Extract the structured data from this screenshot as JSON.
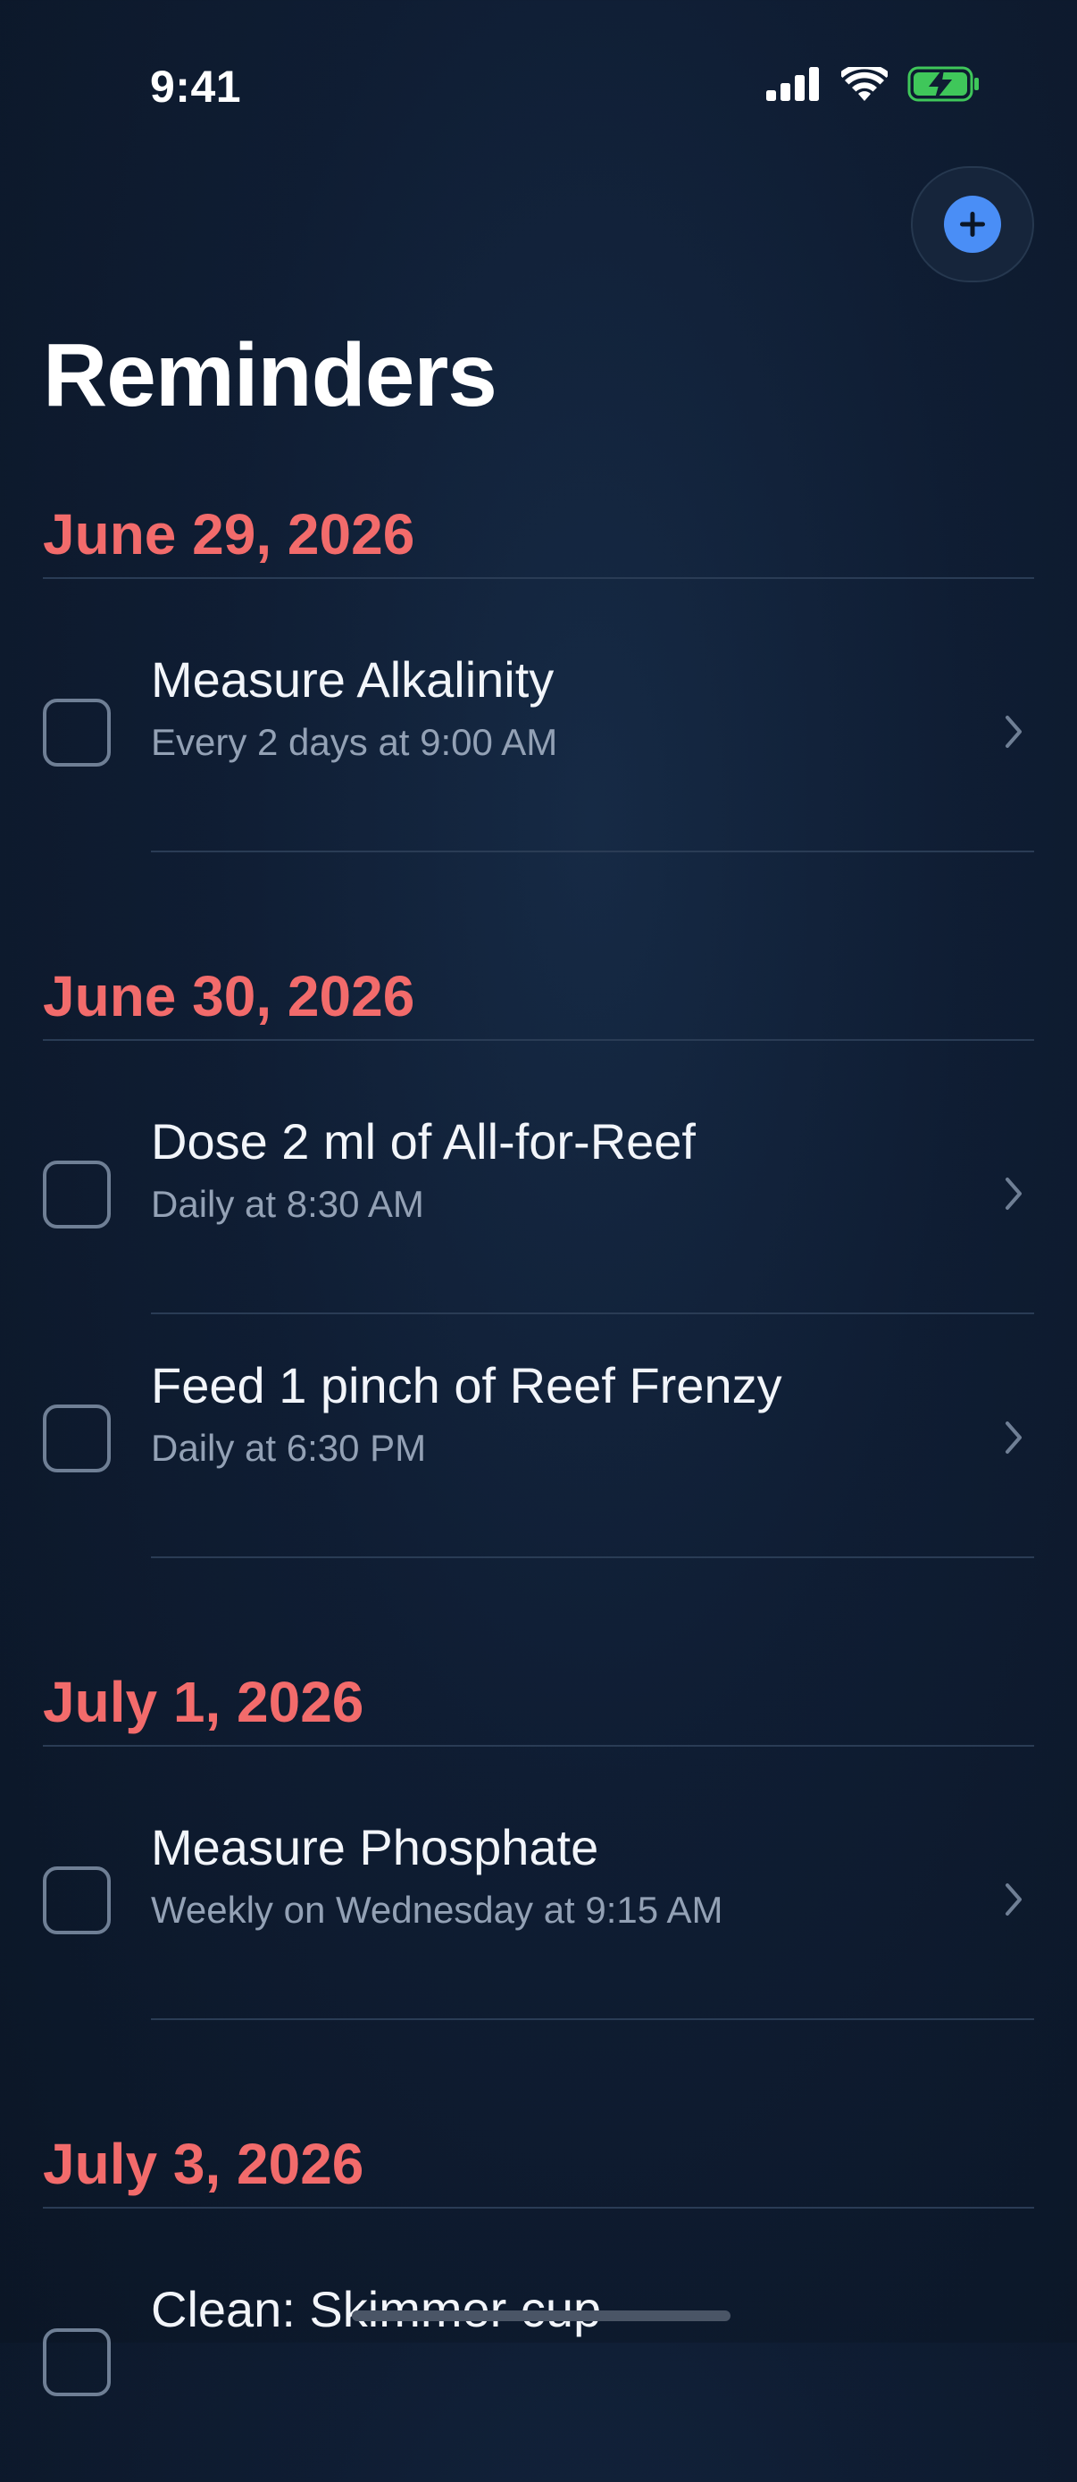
{
  "status_bar": {
    "time": "9:41"
  },
  "header": {
    "title": "Reminders",
    "add_icon": "plus-icon"
  },
  "colors": {
    "accent": "#4a8ef6",
    "section_date": "#f26b6b",
    "background": "#0f1d33"
  },
  "sections": [
    {
      "date": "June 29, 2026",
      "items": [
        {
          "title": "Measure Alkalinity",
          "subtitle": "Every 2 days at 9:00 AM"
        }
      ]
    },
    {
      "date": "June 30, 2026",
      "items": [
        {
          "title": "Dose 2 ml of All-for-Reef",
          "subtitle": "Daily at 8:30 AM"
        },
        {
          "title": "Feed 1 pinch of Reef Frenzy",
          "subtitle": "Daily at 6:30 PM"
        }
      ]
    },
    {
      "date": "July 1, 2026",
      "items": [
        {
          "title": "Measure Phosphate",
          "subtitle": "Weekly on Wednesday at 9:15 AM"
        }
      ]
    },
    {
      "date": "July 3, 2026",
      "items": [
        {
          "title": "Clean: Skimmer cup",
          "subtitle": ""
        }
      ]
    }
  ]
}
